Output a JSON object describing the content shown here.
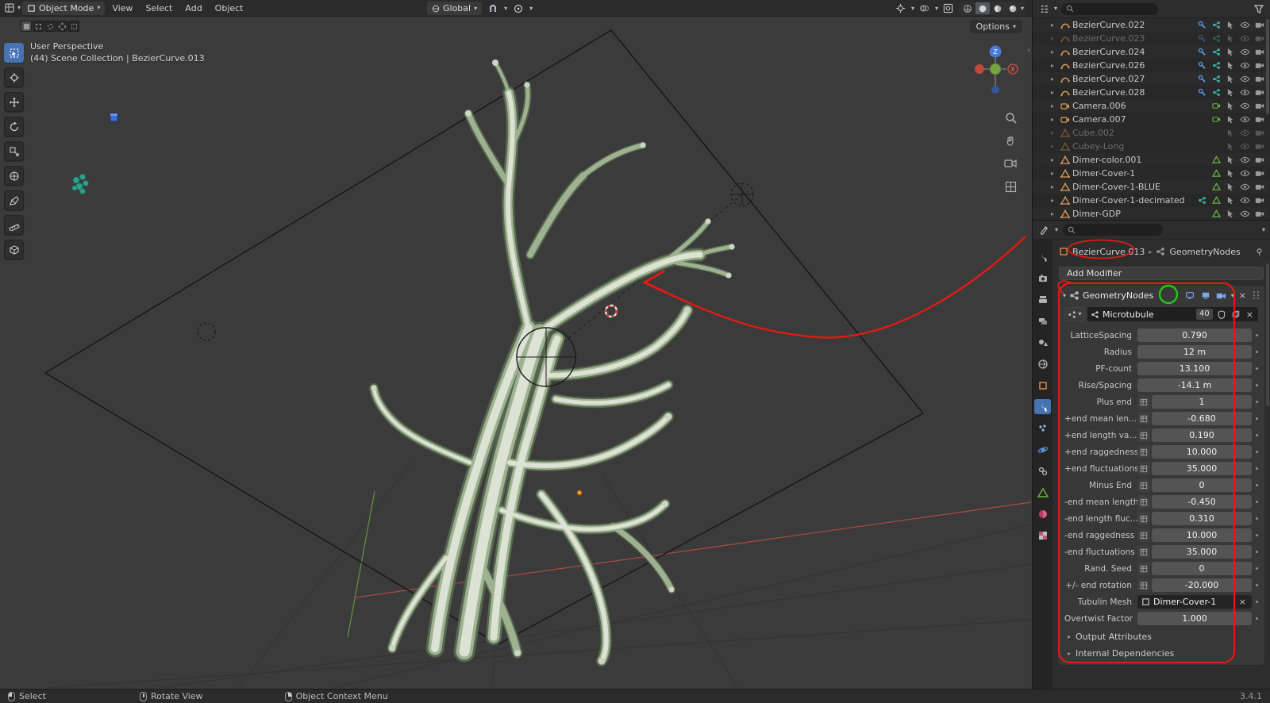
{
  "topbar": {
    "mode": "Object Mode",
    "menus": [
      "View",
      "Select",
      "Add",
      "Object"
    ],
    "orientation": "Global",
    "options_label": "Options"
  },
  "viewport": {
    "overlay_line1": "User Perspective",
    "overlay_line2": "(44) Scene Collection | BezierCurve.013",
    "gizmo_z": "Z",
    "gizmo_x": "X"
  },
  "outliner": {
    "items": [
      {
        "label": "BezierCurve.022",
        "type": "curve",
        "cls": "",
        "mod": true,
        "nodes": true
      },
      {
        "label": "BezierCurve.023",
        "type": "curve",
        "cls": "dim",
        "mod": true,
        "nodes": true
      },
      {
        "label": "BezierCurve.024",
        "type": "curve",
        "cls": "",
        "mod": true,
        "nodes": true
      },
      {
        "label": "BezierCurve.026",
        "type": "curve",
        "cls": "",
        "mod": true,
        "nodes": true
      },
      {
        "label": "BezierCurve.027",
        "type": "curve",
        "cls": "",
        "mod": true,
        "nodes": true
      },
      {
        "label": "BezierCurve.028",
        "type": "curve",
        "cls": "",
        "mod": true,
        "nodes": true
      },
      {
        "label": "Camera.006",
        "type": "camera",
        "cls": "",
        "camdata": true
      },
      {
        "label": "Camera.007",
        "type": "camera",
        "cls": "",
        "camdata": true
      },
      {
        "label": "Cube.002",
        "type": "mesh",
        "cls": "dim"
      },
      {
        "label": "Cubey-Long",
        "type": "mesh",
        "cls": "dim"
      },
      {
        "label": "Dimer-color.001",
        "type": "mesh",
        "cls": "",
        "data": true
      },
      {
        "label": "Dimer-Cover-1",
        "type": "mesh",
        "cls": "",
        "data": true
      },
      {
        "label": "Dimer-Cover-1-BLUE",
        "type": "mesh",
        "cls": "",
        "data": true
      },
      {
        "label": "Dimer-Cover-1-decimated",
        "type": "mesh",
        "cls": "",
        "data": true,
        "nodes": true
      },
      {
        "label": "Dimer-GDP",
        "type": "mesh",
        "cls": "",
        "data": true
      }
    ]
  },
  "properties": {
    "breadcrumb": {
      "object": "BezierCurve.013",
      "node": "GeometryNodes"
    },
    "add_modifier_label": "Add Modifier",
    "modifier": {
      "name": "GeometryNodes",
      "node_group": "Microtubule",
      "users": "40",
      "params": [
        {
          "label": "LatticeSpacing",
          "value": "0.790"
        },
        {
          "label": "Radius",
          "value": "12 m"
        },
        {
          "label": "PF-count",
          "value": "13.100"
        },
        {
          "label": "Rise/Spacing",
          "value": "-14.1 m"
        },
        {
          "label": "Plus end",
          "value": "1",
          "attr": true
        },
        {
          "label": "+end mean len...",
          "value": "-0.680",
          "attr": true
        },
        {
          "label": "+end length va...",
          "value": "0.190",
          "attr": true
        },
        {
          "label": "+end raggedness",
          "value": "10.000",
          "attr": true
        },
        {
          "label": "+end fluctuations",
          "value": "35.000",
          "attr": true
        },
        {
          "label": "Minus End",
          "value": "0",
          "attr": true
        },
        {
          "label": "-end mean length",
          "value": "-0.450",
          "attr": true
        },
        {
          "label": "-end length fluc...",
          "value": "0.310",
          "attr": true
        },
        {
          "label": "-end raggedness",
          "value": "10.000",
          "attr": true
        },
        {
          "label": "-end fluctuations",
          "value": "35.000",
          "attr": true
        },
        {
          "label": "Rand. Seed",
          "value": "0",
          "attr": true
        },
        {
          "label": "+/- end rotation",
          "value": "-20.000",
          "attr": true
        },
        {
          "label": "Tubulin Mesh",
          "value": "Dimer-Cover-1",
          "object_field": true
        },
        {
          "label": "Overtwist Factor",
          "value": "1.000"
        }
      ],
      "sections": [
        "Output Attributes",
        "Internal Dependencies"
      ]
    }
  },
  "statusbar": {
    "select": "Select",
    "rotate": "Rotate View",
    "context": "Object Context Menu",
    "version": "3.4.1"
  }
}
